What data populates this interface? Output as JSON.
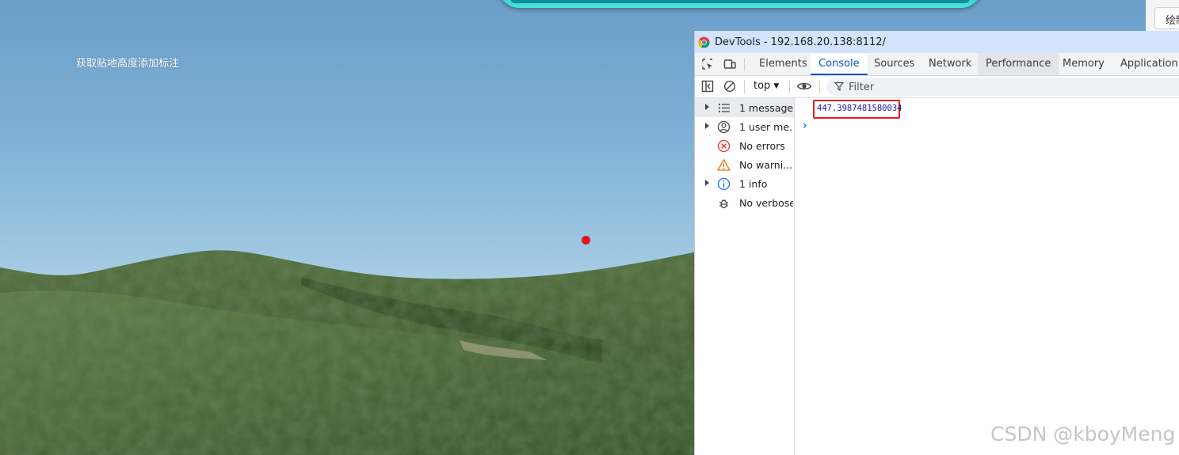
{
  "scene": {
    "title": "获取贴地高度添加标注",
    "marker_color": "#e8111b",
    "top_bar_color": "#0fb7b7"
  },
  "corner_button": {
    "label": "绘制"
  },
  "devtools": {
    "window_title": "DevTools - 192.168.20.138:8112/",
    "tabs": [
      {
        "label": "Elements"
      },
      {
        "label": "Console"
      },
      {
        "label": "Sources"
      },
      {
        "label": "Network"
      },
      {
        "label": "Performance"
      },
      {
        "label": "Memory"
      },
      {
        "label": "Application"
      }
    ],
    "active_tab": "Console",
    "toolbar": {
      "context": "top",
      "filter_placeholder": "Filter"
    },
    "sidebar": [
      {
        "label": "1 message",
        "icon": "list-icon"
      },
      {
        "label": "1 user me...",
        "icon": "user-icon"
      },
      {
        "label": "No errors",
        "icon": "error-icon"
      },
      {
        "label": "No warni...",
        "icon": "warning-icon"
      },
      {
        "label": "1 info",
        "icon": "info-icon"
      },
      {
        "label": "No verbose",
        "icon": "bug-icon"
      }
    ],
    "console": {
      "log_value": "447.3987481580034",
      "prompt": "›"
    },
    "colors": {
      "accent": "#0b57d0",
      "titlebar": "#d3e3fd",
      "highlight": "#e81c1c"
    }
  },
  "watermark": "CSDN @kboyMeng"
}
